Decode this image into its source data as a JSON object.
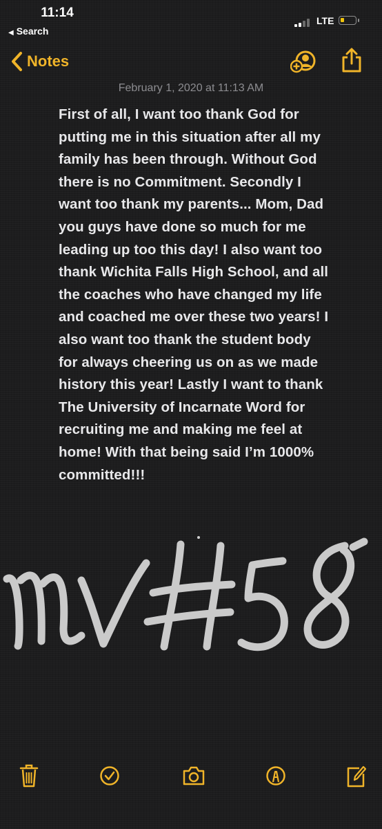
{
  "status_bar": {
    "time": "11:14",
    "back_to_app": "Search",
    "network": "LTE",
    "battery_level": 0.25,
    "signal_bars": 2
  },
  "nav": {
    "back_label": "Notes",
    "accent_color": "#f0b429",
    "icons": [
      "chevron-left-icon",
      "add-people-icon",
      "share-icon"
    ]
  },
  "note": {
    "date": "February 1, 2020 at 11:13 AM",
    "lines": [
      "First of all, I want too thank God for",
      "putting me in this situation after all my",
      "family has been through. Without God",
      "there is no Commitment. Secondly I",
      "want too thank my parents... Mom, Dad",
      "you guys have done so much for me",
      "leading up too this day! I also want too",
      "thank Wichita Falls High School, and all",
      "the coaches who have changed my life",
      "and coached me over these two years! I",
      "also want too thank the student body",
      "for always cheering us on as we made",
      "history this year! Lastly I want to thank",
      "The University of Incarnate Word for",
      "recruiting me and making me feel at",
      "home! With that being said I’m 1000%",
      "committed!!!"
    ],
    "sketch_text": "MV #58"
  },
  "toolbar": {
    "icons": [
      "trash-icon",
      "checklist-icon",
      "camera-icon",
      "markup-icon",
      "compose-icon"
    ]
  }
}
